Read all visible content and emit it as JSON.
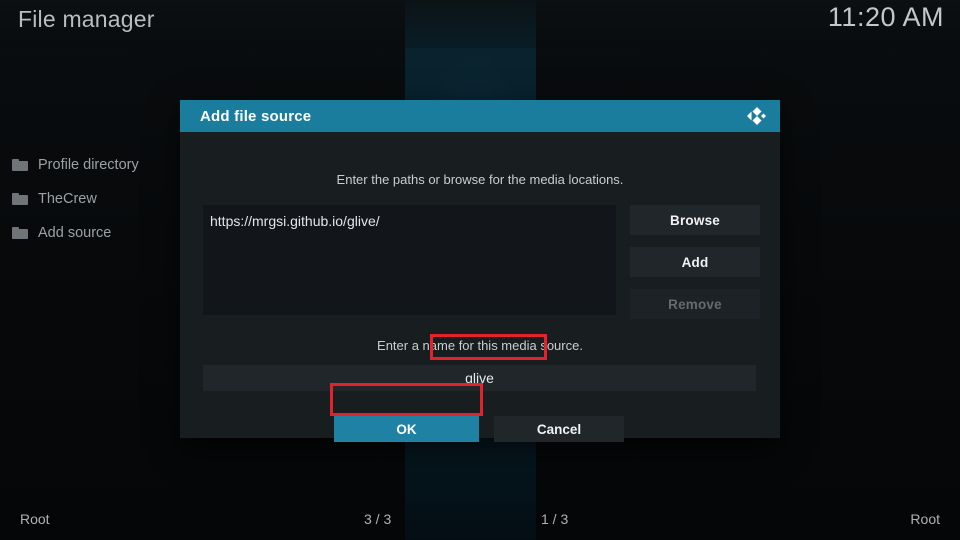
{
  "header": {
    "app_title": "File manager",
    "clock": "11:20 AM"
  },
  "sidebar": {
    "items": [
      {
        "label": "Profile directory",
        "icon": "folder-icon"
      },
      {
        "label": "TheCrew",
        "icon": "folder-icon"
      },
      {
        "label": "Add source",
        "icon": "folder-icon"
      }
    ]
  },
  "dialog": {
    "title": "Add file source",
    "logo_icon": "kodi-logo-icon",
    "paths_hint": "Enter the paths or browse for the media locations.",
    "paths": [
      "https://mrgsi.github.io/glive/"
    ],
    "side_buttons": [
      {
        "label": "Browse",
        "disabled": false
      },
      {
        "label": "Add",
        "disabled": false
      },
      {
        "label": "Remove",
        "disabled": true
      }
    ],
    "name_hint": "Enter a name for this media source.",
    "name_value": "glive",
    "ok_label": "OK",
    "cancel_label": "Cancel"
  },
  "footer": {
    "left": "Root",
    "center_left": "3 / 3",
    "center_right": "1 / 3",
    "right": "Root"
  },
  "colors": {
    "accent_teal": "#1a7d9e",
    "ok_teal": "#1f81a3",
    "annotation_red": "#e4222c",
    "dialog_bg": "#181d1f",
    "panel_bg": "#20262a"
  }
}
